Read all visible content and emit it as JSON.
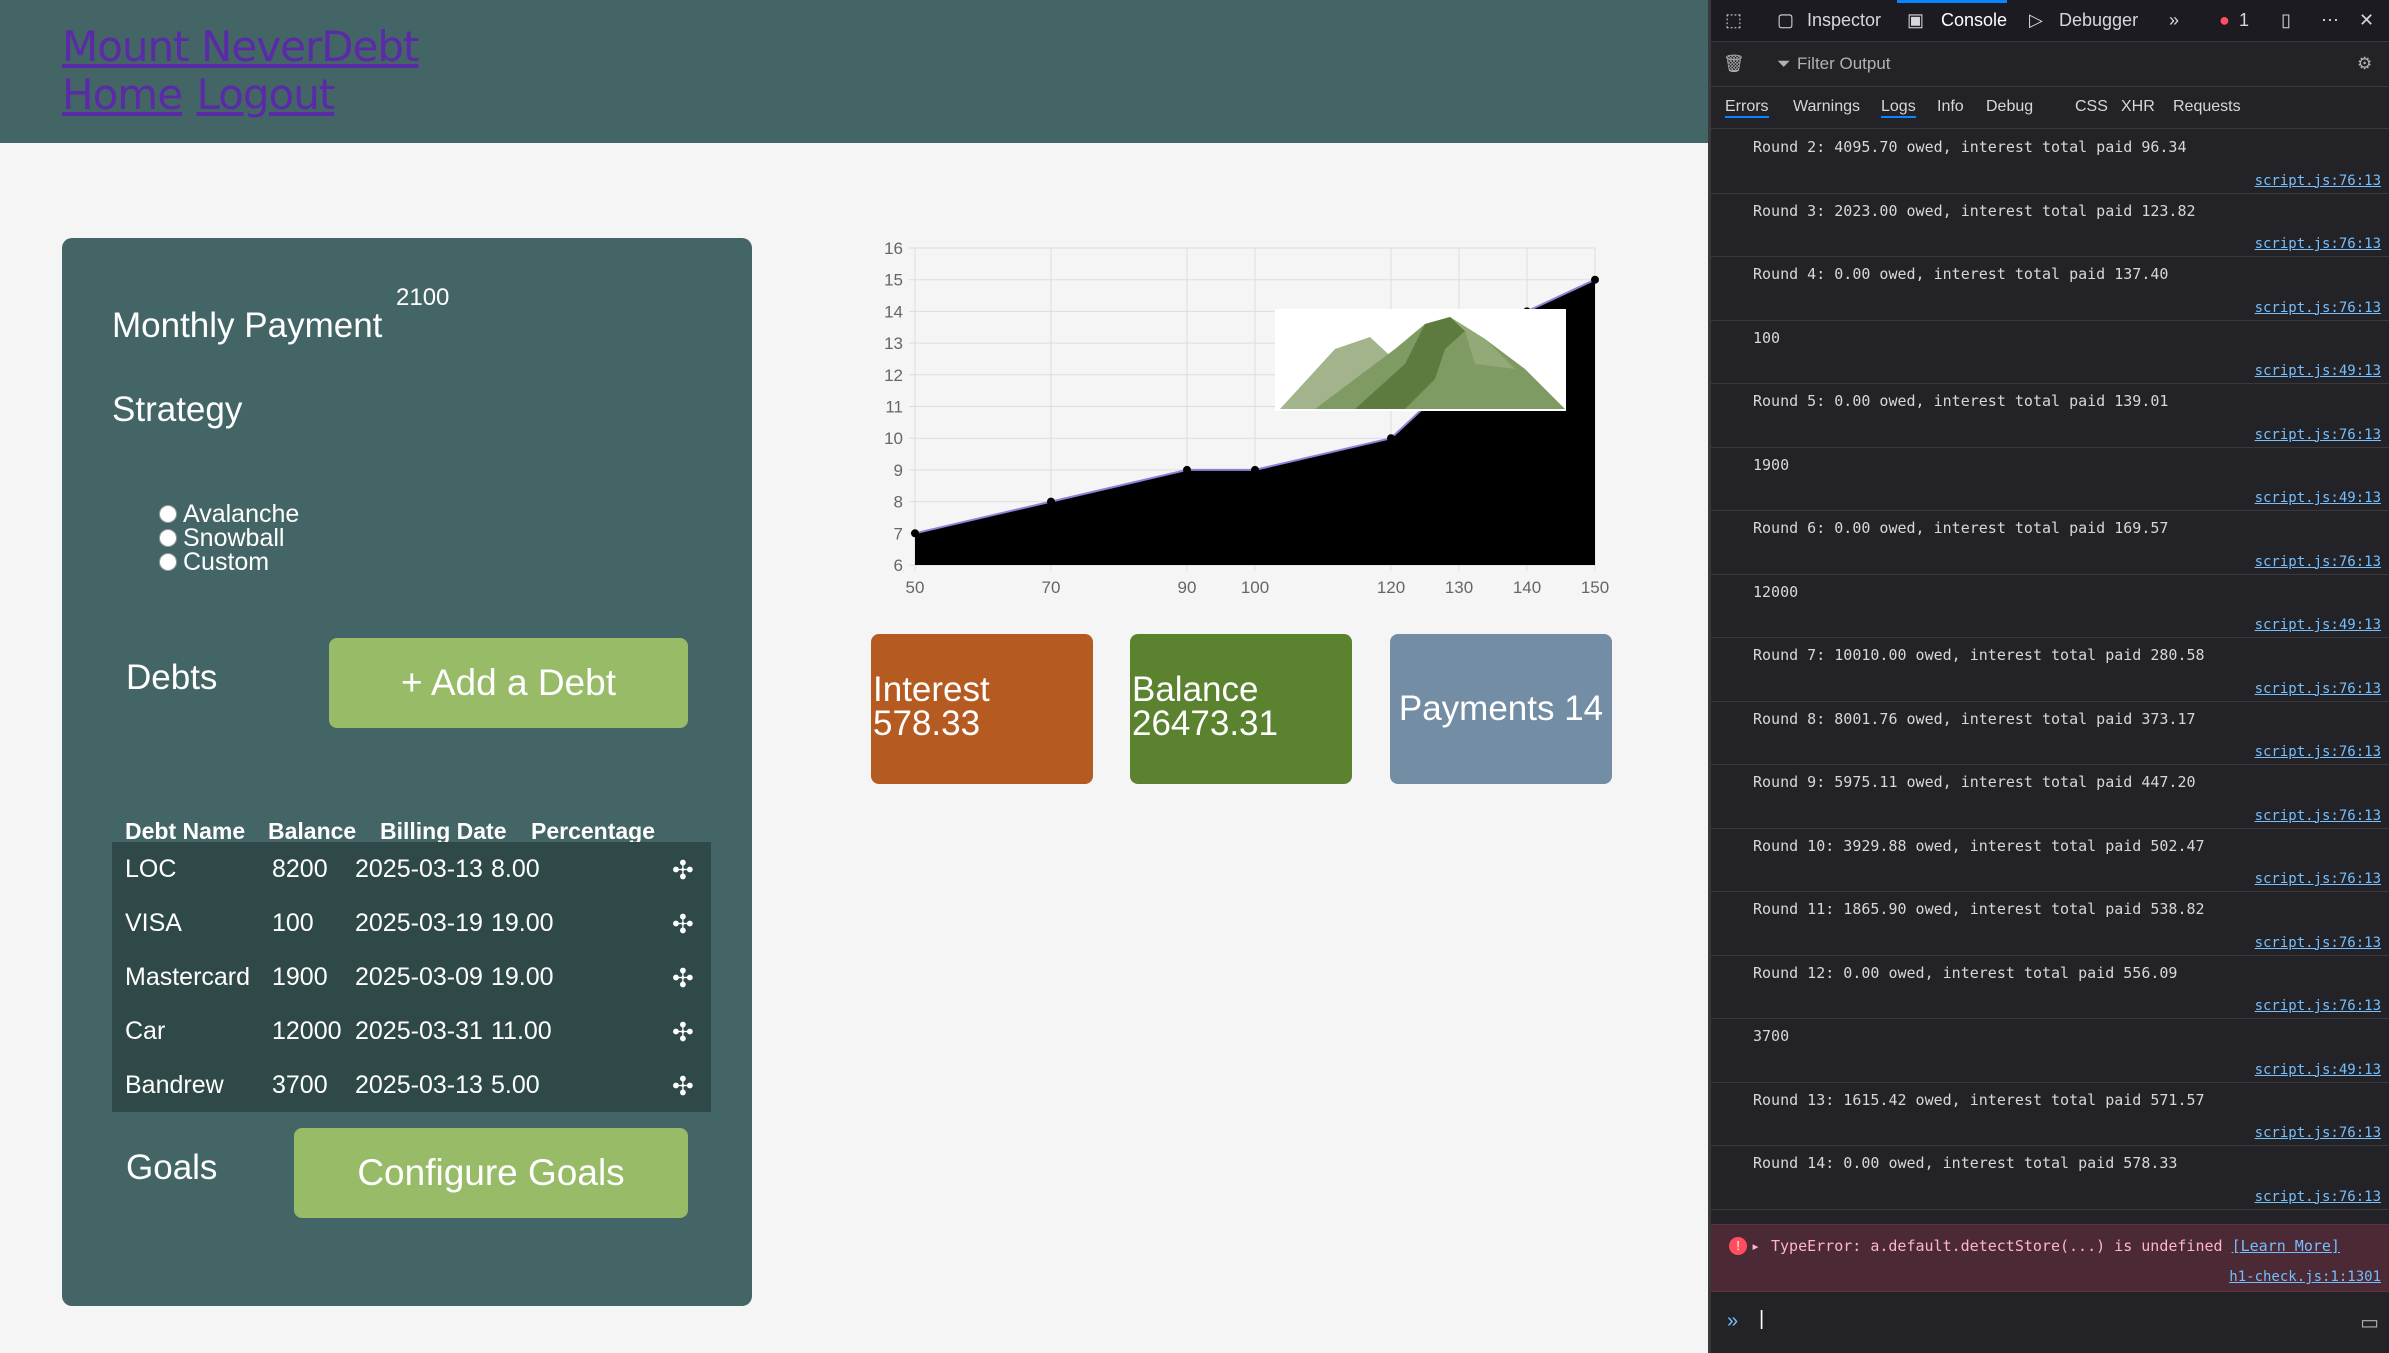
{
  "header": {
    "brand": "Mount NeverDebt",
    "home": "Home",
    "logout": "Logout"
  },
  "panel": {
    "monthly_label": "Monthly Payment",
    "monthly_value": "2100",
    "strategy_label": "Strategy",
    "strategies": [
      "Avalanche",
      "Snowball",
      "Custom"
    ],
    "debts_label": "Debts",
    "add_debt": "+ Add a Debt",
    "goals_label": "Goals",
    "configure_goals": "Configure Goals",
    "columns": [
      "Debt Name",
      "Balance",
      "Billing Date",
      "Percentage"
    ],
    "rows": [
      [
        "LOC",
        "8200",
        "2025-03-13",
        "8.00"
      ],
      [
        "VISA",
        "100",
        "2025-03-19",
        "19.00"
      ],
      [
        "Mastercard",
        "1900",
        "2025-03-09",
        "19.00"
      ],
      [
        "Car",
        "12000",
        "2025-03-31",
        "11.00"
      ],
      [
        "Bandrew",
        "3700",
        "2025-03-13",
        "5.00"
      ]
    ]
  },
  "chart_data": {
    "type": "area",
    "x": [
      50,
      70,
      90,
      100,
      120,
      130,
      140,
      150
    ],
    "y": [
      7,
      8,
      9,
      9,
      10,
      12,
      14,
      15
    ],
    "xlim": [
      50,
      150
    ],
    "ylim": [
      6,
      16
    ],
    "xticks": [
      50,
      70,
      90,
      100,
      120,
      130,
      140,
      150
    ],
    "yticks": [
      6,
      7,
      8,
      9,
      10,
      11,
      12,
      13,
      14,
      15,
      16
    ],
    "grid": true,
    "fill_color": "#000000",
    "line_color": "#8f7fd8"
  },
  "cards": {
    "interest_label": "Interest",
    "interest_value": "578.33",
    "balance_label": "Balance",
    "balance_value": "26473.31",
    "payments_text": "Payments 14"
  },
  "devtools": {
    "tabs": [
      "Inspector",
      "Console",
      "Debugger"
    ],
    "error_count": "1",
    "filter_placeholder": "Filter Output",
    "levels": [
      "Errors",
      "Warnings",
      "Logs",
      "Info",
      "Debug",
      "CSS",
      "XHR",
      "Requests"
    ],
    "messages": [
      {
        "text": "Round 2: 4095.70 owed, interest total paid 96.34",
        "src": "script.js:76:13"
      },
      {
        "text": "Round 3: 2023.00 owed, interest total paid 123.82",
        "src": "script.js:76:13"
      },
      {
        "text": "Round 4: 0.00 owed, interest total paid 137.40",
        "src": "script.js:76:13"
      },
      {
        "text": "100",
        "src": "script.js:49:13"
      },
      {
        "text": "Round 5: 0.00 owed, interest total paid 139.01",
        "src": "script.js:76:13"
      },
      {
        "text": "1900",
        "src": "script.js:49:13"
      },
      {
        "text": "Round 6: 0.00 owed, interest total paid 169.57",
        "src": "script.js:76:13"
      },
      {
        "text": "12000",
        "src": "script.js:49:13"
      },
      {
        "text": "Round 7: 10010.00 owed, interest total paid 280.58",
        "src": "script.js:76:13"
      },
      {
        "text": "Round 8: 8001.76 owed, interest total paid 373.17",
        "src": "script.js:76:13"
      },
      {
        "text": "Round 9: 5975.11 owed, interest total paid 447.20",
        "src": "script.js:76:13"
      },
      {
        "text": "Round 10: 3929.88 owed, interest total paid 502.47",
        "src": "script.js:76:13"
      },
      {
        "text": "Round 11: 1865.90 owed, interest total paid 538.82",
        "src": "script.js:76:13"
      },
      {
        "text": "Round 12: 0.00 owed, interest total paid 556.09",
        "src": "script.js:76:13"
      },
      {
        "text": "3700",
        "src": "script.js:49:13"
      },
      {
        "text": "Round 13: 1615.42 owed, interest total paid 571.57",
        "src": "script.js:76:13"
      },
      {
        "text": "Round 14: 0.00 owed, interest total paid 578.33",
        "src": "script.js:76:13"
      }
    ],
    "error": {
      "text": "TypeError: a.default.detectStore(...) is undefined",
      "learn": "[Learn More]",
      "src": "h1-check.js:1:1301"
    },
    "prompt_icon": "chevron-double-right-icon"
  }
}
